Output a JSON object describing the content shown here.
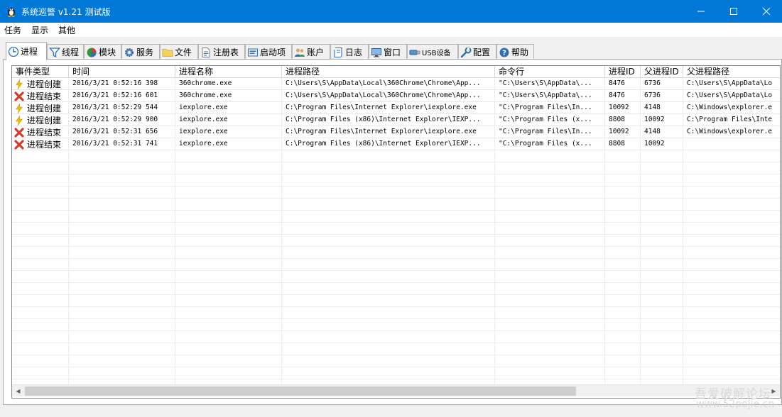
{
  "window": {
    "title": "系统巡警 v1.21 测试版",
    "controls": {
      "minimize": "—",
      "maximize": "☐",
      "close": "✕"
    }
  },
  "menu": [
    {
      "label": "任务"
    },
    {
      "label": "显示"
    },
    {
      "label": "其他"
    }
  ],
  "tabs": [
    {
      "label": "进程",
      "icon": "process-icon",
      "active": true
    },
    {
      "label": "线程",
      "icon": "filter-icon"
    },
    {
      "label": "模块",
      "icon": "module-pie-icon"
    },
    {
      "label": "服务",
      "icon": "gear-icon"
    },
    {
      "label": "文件",
      "icon": "folder-icon"
    },
    {
      "label": "注册表",
      "icon": "registry-doc-icon"
    },
    {
      "label": "启动项",
      "icon": "startup-icon"
    },
    {
      "label": "账户",
      "icon": "users-icon"
    },
    {
      "label": "日志",
      "icon": "log-scroll-icon"
    },
    {
      "label": "窗口",
      "icon": "window-monitor-icon"
    },
    {
      "label": "USB设备",
      "icon": "usb-icon"
    },
    {
      "label": "配置",
      "icon": "wrench-icon"
    },
    {
      "label": "帮助",
      "icon": "help-icon"
    }
  ],
  "table": {
    "columns": [
      "事件类型",
      "时间",
      "进程名称",
      "进程路径",
      "命令行",
      "进程ID",
      "父进程ID",
      "父进程路径"
    ],
    "rows": [
      {
        "type": "进程创建",
        "kind": "create",
        "time": "2016/3/21 0:52:16 398",
        "name": "360chrome.exe",
        "path": "C:\\Users\\S\\AppData\\Local\\360Chrome\\Chrome\\App...",
        "cmd": "\"C:\\Users\\S\\AppData\\...",
        "pid": "8476",
        "ppid": "6736",
        "ppath": "C:\\Users\\S\\AppData\\Lo"
      },
      {
        "type": "进程结束",
        "kind": "end",
        "time": "2016/3/21 0:52:16 601",
        "name": "360chrome.exe",
        "path": "C:\\Users\\S\\AppData\\Local\\360Chrome\\Chrome\\App...",
        "cmd": "\"C:\\Users\\S\\AppData\\...",
        "pid": "8476",
        "ppid": "6736",
        "ppath": "C:\\Users\\S\\AppData\\Lo"
      },
      {
        "type": "进程创建",
        "kind": "create",
        "time": "2016/3/21 0:52:29 544",
        "name": "iexplore.exe",
        "path": "C:\\Program Files\\Internet Explorer\\iexplore.exe",
        "cmd": "\"C:\\Program Files\\In...",
        "pid": "10092",
        "ppid": "4148",
        "ppath": "C:\\Windows\\explorer.e"
      },
      {
        "type": "进程创建",
        "kind": "create",
        "time": "2016/3/21 0:52:29 900",
        "name": "iexplore.exe",
        "path": "C:\\Program Files (x86)\\Internet Explorer\\IEXP...",
        "cmd": "\"C:\\Program Files (x...",
        "pid": "8808",
        "ppid": "10092",
        "ppath": "C:\\Program Files\\Inte"
      },
      {
        "type": "进程结束",
        "kind": "end",
        "time": "2016/3/21 0:52:31 656",
        "name": "iexplore.exe",
        "path": "C:\\Program Files\\Internet Explorer\\iexplore.exe",
        "cmd": "\"C:\\Program Files\\In...",
        "pid": "10092",
        "ppid": "4148",
        "ppath": "C:\\Windows\\explorer.e"
      },
      {
        "type": "进程结束",
        "kind": "end",
        "time": "2016/3/21 0:52:31 741",
        "name": "iexplore.exe",
        "path": "C:\\Program Files (x86)\\Internet Explorer\\IEXP...",
        "cmd": "\"C:\\Program Files (x...",
        "pid": "8808",
        "ppid": "10092",
        "ppath": ""
      }
    ]
  },
  "watermark": {
    "line1": "吾爱破解论坛",
    "line2": "www.52pojie.cn"
  },
  "colors": {
    "titlebar": "#0078d7",
    "create_icon": "#f5b800",
    "end_icon": "#d23c2a"
  }
}
